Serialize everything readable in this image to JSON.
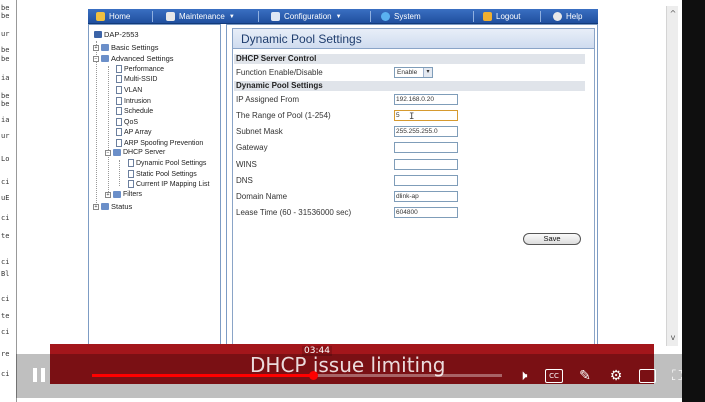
{
  "background_doc": {
    "fragments": [
      "be",
      "be",
      "ur",
      "be",
      "be",
      "ia",
      "be",
      "be",
      "ia",
      "ur",
      "Lo",
      "ci",
      "uE",
      "ci",
      "te",
      "ci",
      "Bl",
      "ci",
      "te",
      "ci",
      "re",
      "ci"
    ]
  },
  "topnav": {
    "items": [
      {
        "label": "Home",
        "icon": "home-icon"
      },
      {
        "label": "Maintenance",
        "icon": "tools-icon",
        "dropdown": true
      },
      {
        "label": "Configuration",
        "icon": "config-icon",
        "dropdown": true
      },
      {
        "label": "System",
        "icon": "system-icon"
      },
      {
        "label": "Logout",
        "icon": "logout-icon"
      },
      {
        "label": "Help",
        "icon": "help-icon"
      }
    ],
    "dropdown_glyph": "▼"
  },
  "tree": {
    "root": "DAP-2553",
    "basic": "Basic Settings",
    "advanced": "Advanced Settings",
    "performance": "Performance",
    "multi_ssid": "Multi-SSID",
    "vlan": "VLAN",
    "intrusion": "Intrusion",
    "schedule": "Schedule",
    "qos": "QoS",
    "ap_array": "AP Array",
    "arp": "ARP Spoofing Prevention",
    "dhcp_server": "DHCP Server",
    "dynamic_pool": "Dynamic Pool Settings",
    "static_pool": "Static Pool Settings",
    "ip_mapping": "Current IP Mapping List",
    "filters": "Filters",
    "status": "Status",
    "expand_glyph": "+",
    "collapse_glyph": "−"
  },
  "panel": {
    "title": "Dynamic Pool Settings",
    "section_control": "DHCP Server Control",
    "function_label": "Function Enable/Disable",
    "function_value": "Enable",
    "section_settings": "Dynamic Pool Settings",
    "ip_from_label": "IP Assigned From",
    "ip_from_value": "192.168.0.20",
    "range_label": "The Range of Pool (1-254)",
    "range_value": "5",
    "mask_label": "Subnet Mask",
    "mask_value": "255.255.255.0",
    "gateway_label": "Gateway",
    "gateway_value": "",
    "wins_label": "WINS",
    "wins_value": "",
    "dns_label": "DNS",
    "dns_value": "",
    "domain_label": "Domain Name",
    "domain_value": "dlink-ap",
    "lease_label": "Lease Time (60 - 31536000 sec)",
    "lease_value": "604800",
    "save_label": "Save",
    "select_arrow": "▾"
  },
  "video": {
    "caption": "DHCP issue limiting",
    "time": "03:44",
    "progress_fraction": 0.54,
    "accent_color": "#ff0000",
    "banner_color": "#a3161b"
  },
  "scrollbar": {
    "up": "^",
    "down": "v"
  }
}
